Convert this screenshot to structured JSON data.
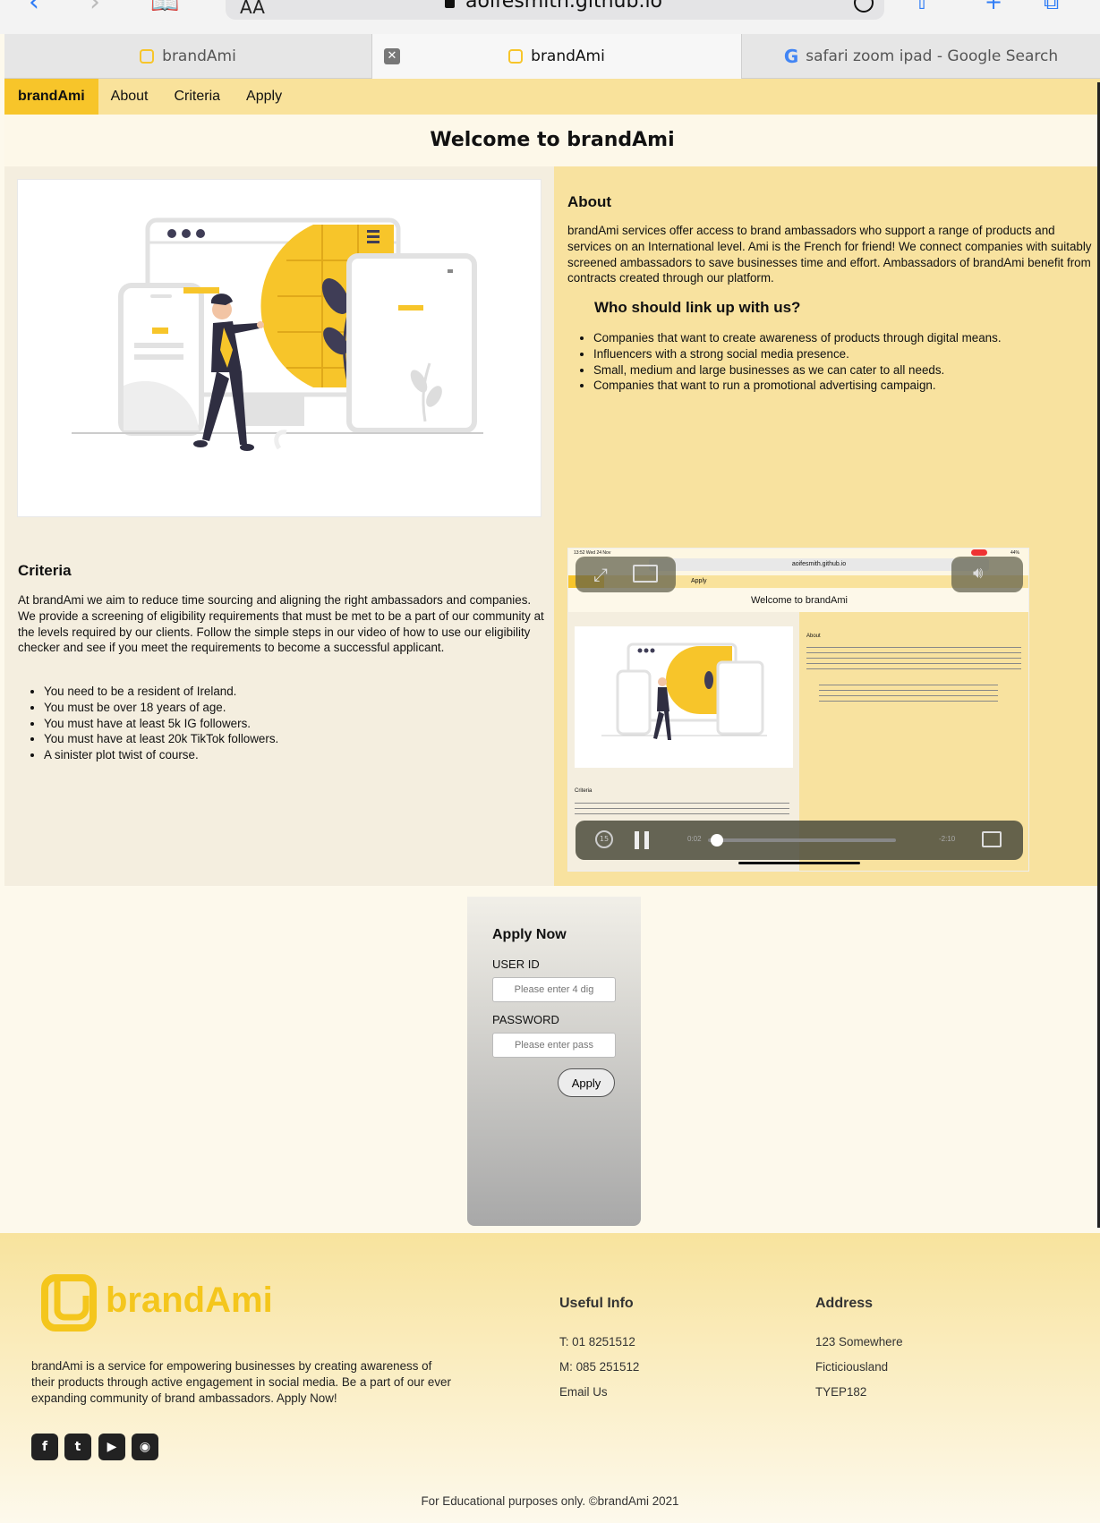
{
  "browser": {
    "text_size_label": "AA",
    "url": "aoifesmith.github.io",
    "tabs": [
      {
        "label": "brandAmi"
      },
      {
        "label": "brandAmi"
      },
      {
        "label": "safari zoom ipad - Google Search"
      }
    ]
  },
  "nav": {
    "brand": "brandAmi",
    "links": [
      "About",
      "Criteria",
      "Apply"
    ]
  },
  "hero": {
    "title": "Welcome to brandAmi"
  },
  "about": {
    "heading": "About",
    "text": "brandAmi services offer access to brand ambassadors who support a range of products and services on an International level. Ami is the French for friend! We connect companies with suitably screened ambassadors to save businesses time and effort. Ambassadors of brandAmi benefit from contracts created through our platform.",
    "subheading": "Who should link up with us?",
    "items": [
      "Companies that want to create awareness of products through digital means.",
      "Influencers with a strong social media presence.",
      "Small, medium and large businesses as we can cater to all needs.",
      "Companies that want to run a promotional advertising campaign."
    ]
  },
  "criteria": {
    "heading": "Criteria",
    "text": "At brandAmi we aim to reduce time sourcing and aligning the right ambassadors and companies. We provide a screening of eligibility requirements that must be met to be a part of our community at the levels required by our clients. Follow the simple steps in our video of how to use our eligibility checker and see if you meet the requirements to become a successful applicant.",
    "items": [
      "You need to be a resident of Ireland.",
      "You must be over 18 years of age.",
      "You must have at least 5k IG followers.",
      "You must have at least 20k TikTok followers.",
      "A sinister plot twist of course."
    ]
  },
  "video": {
    "status_time": "13:52  Wed 24 Nov",
    "battery": "44%",
    "url": "aoifesmith.github.io",
    "nav_link": "Apply",
    "title": "Welcome to brandAmi",
    "about_heading": "About",
    "criteria_heading": "Criteria",
    "elapsed": "0:02",
    "remaining": "-2:10",
    "progress": 0.015
  },
  "apply": {
    "title": "Apply Now",
    "user_label": "USER ID",
    "user_placeholder": "Please enter 4 dig",
    "password_label": "PASSWORD",
    "password_placeholder": "Please enter pass",
    "button": "Apply"
  },
  "footer": {
    "logo_text": "brandAmi",
    "description": "brandAmi is a service for empowering businesses by creating awareness of their products through active engagement in social media. Be a part of our ever expanding community of brand ambassadors. Apply Now!",
    "social": [
      "facebook-icon",
      "twitter-icon",
      "youtube-icon",
      "github-icon"
    ],
    "useful_heading": "Useful Info",
    "phone": "T: 01 8251512",
    "mobile": "M: 085 251512",
    "email": "Email Us",
    "address_heading": "Address",
    "address": [
      "123 Somewhere",
      "Ficticiousland",
      "TYEP182"
    ],
    "copyright": "For Educational purposes only. ©brandAmi 2021"
  },
  "colors": {
    "accent": "#f7c52a",
    "nav_bg": "#f9e29b",
    "safari_blue": "#2f7cf6"
  }
}
